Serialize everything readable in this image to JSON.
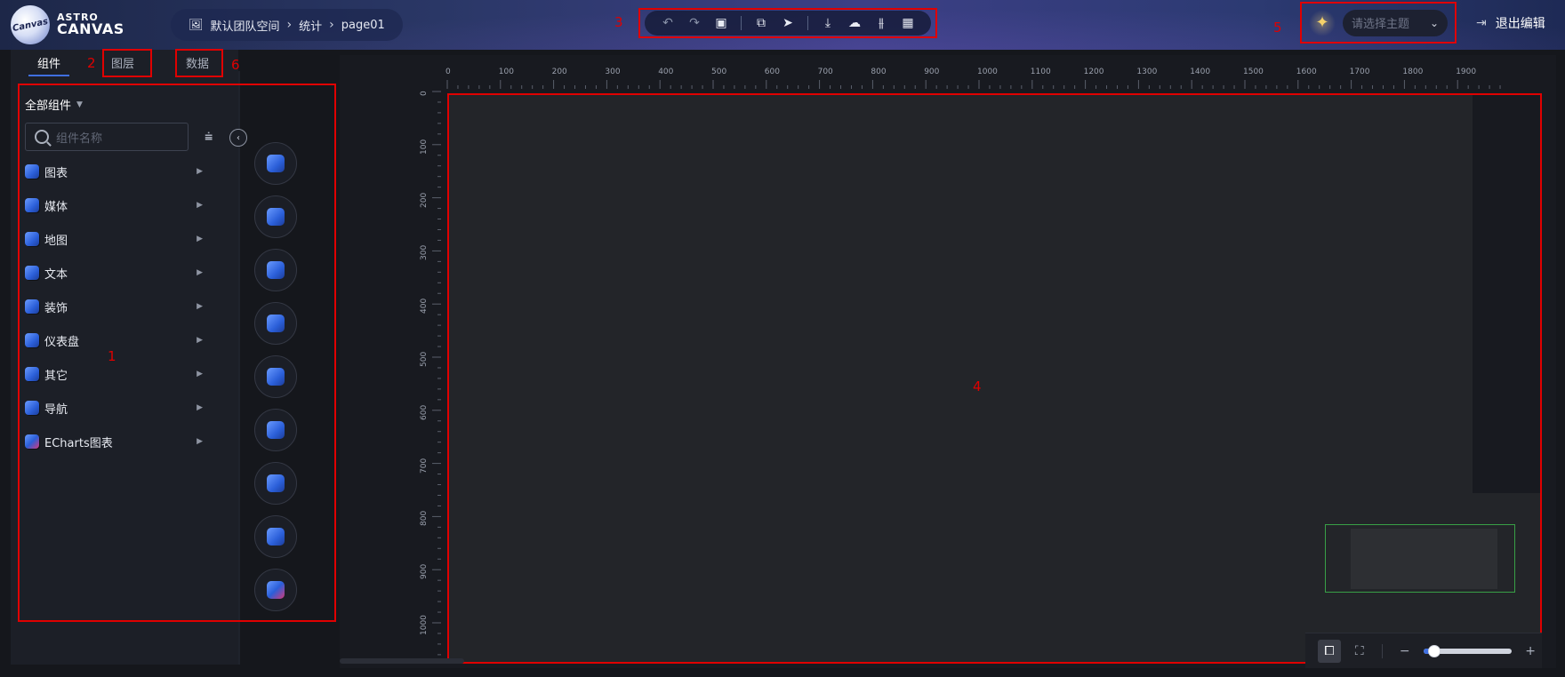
{
  "header": {
    "logo": {
      "line1": "ASTRO",
      "line2": "CANVAS",
      "badge": "Canvas"
    },
    "breadcrumb": {
      "items": [
        "默认团队空间",
        "统计",
        "page01"
      ],
      "separator": "›"
    },
    "toolbar": {
      "buttons": [
        {
          "name": "undo",
          "icon": "↶",
          "disabled": true
        },
        {
          "name": "redo",
          "icon": "↷",
          "disabled": true
        },
        {
          "name": "save",
          "icon": "▣"
        },
        {
          "name": "preview",
          "icon": "⧉"
        },
        {
          "name": "publish",
          "icon": "➤"
        },
        {
          "name": "download",
          "icon": "⤓"
        },
        {
          "name": "upload",
          "icon": "☁"
        },
        {
          "name": "settings",
          "icon": "⫵"
        },
        {
          "name": "page-settings",
          "icon": "▦"
        }
      ]
    },
    "theme": {
      "placeholder": "请选择主题",
      "icon": "✦"
    },
    "exit_label": "退出编辑"
  },
  "annotations": {
    "a1": "1",
    "a2": "2",
    "a3": "3",
    "a4": "4",
    "a5": "5",
    "a6": "6"
  },
  "left_panel": {
    "tabs": {
      "components": "组件",
      "layers": "图层",
      "data": "数据"
    },
    "all_components": "全部组件",
    "search_placeholder": "组件名称",
    "items": [
      {
        "label": "图表",
        "icon": "chart-cube-icon"
      },
      {
        "label": "媒体",
        "icon": "media-cube-icon"
      },
      {
        "label": "地图",
        "icon": "map-cube-icon"
      },
      {
        "label": "文本",
        "icon": "text-cube-icon"
      },
      {
        "label": "装饰",
        "icon": "decoration-cube-icon"
      },
      {
        "label": "仪表盘",
        "icon": "gauge-cube-icon"
      },
      {
        "label": "其它",
        "icon": "other-cube-icon"
      },
      {
        "label": "导航",
        "icon": "navigation-cube-icon"
      },
      {
        "label": "ECharts图表",
        "icon": "echarts-cube-icon"
      }
    ]
  },
  "rulers": {
    "top": [
      "0",
      "100",
      "200",
      "300",
      "400",
      "500",
      "600",
      "700",
      "800",
      "900",
      "1000",
      "1100",
      "1200",
      "1300",
      "1400",
      "1500",
      "1600",
      "1700",
      "1800",
      "1900"
    ],
    "left": [
      "0",
      "100",
      "200",
      "300",
      "400",
      "500",
      "600",
      "700",
      "800",
      "900",
      "1000"
    ]
  },
  "zoom": {
    "level": 0.12
  },
  "colors": {
    "accent": "#3f6fe0",
    "annotation": "#e00000",
    "minimap": "#38a046"
  }
}
